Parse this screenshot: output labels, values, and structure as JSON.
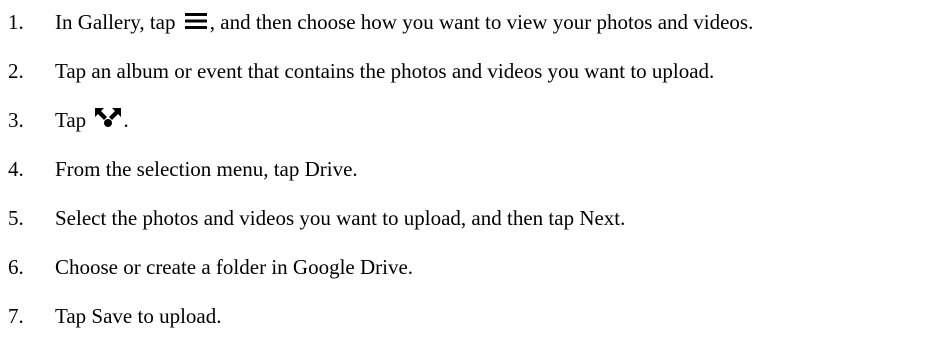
{
  "steps": [
    {
      "number": "1.",
      "text_before": "In Gallery, tap",
      "icon": "menu-icon",
      "text_after": ", and then choose how you want to view your photos and videos."
    },
    {
      "number": "2.",
      "text": "Tap an album or event that contains the photos and videos you want to upload."
    },
    {
      "number": "3.",
      "text_before": "Tap",
      "icon": "share-icon",
      "text_after": "."
    },
    {
      "number": "4.",
      "text": "From the selection menu, tap Drive."
    },
    {
      "number": "5.",
      "text": "Select the photos and videos you want to upload, and then tap Next."
    },
    {
      "number": "6.",
      "text": "Choose or create a folder in Google Drive."
    },
    {
      "number": "7.",
      "text": "Tap Save to upload."
    }
  ]
}
